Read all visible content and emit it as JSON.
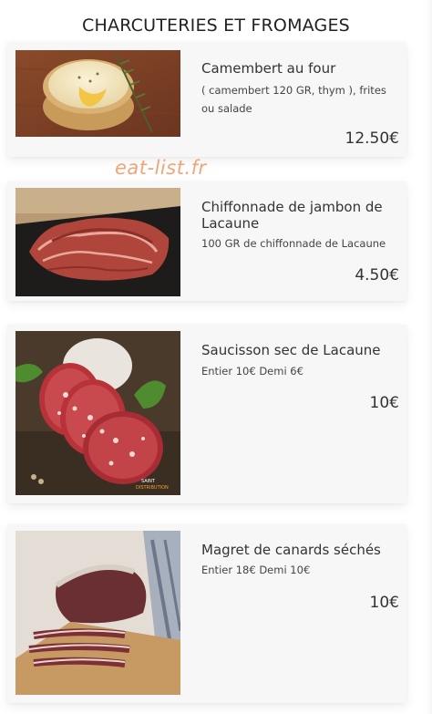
{
  "section": {
    "title": "CHARCUTERIES ET FROMAGES"
  },
  "watermark": "eat-list.fr",
  "items": [
    {
      "name": "Camembert au four",
      "description": "( camembert 120 GR, thym ), frites ou salade",
      "price": "12.50€",
      "image_icon": "camembert-photo"
    },
    {
      "name": "Chiffonnade de jambon de Lacaune",
      "description": "100 GR de chiffonnade de Lacaune",
      "price": "4.50€",
      "image_icon": "ham-photo"
    },
    {
      "name": "Saucisson sec de Lacaune",
      "description": "Entier 10€ Demi 6€",
      "price": "10€",
      "image_icon": "saucisson-photo",
      "image_caption_line1": "SAINT",
      "image_caption_line2": "DISTRIBUTION"
    },
    {
      "name": "Magret de canards séchés",
      "description": "Entier 18€ Demi 10€",
      "price": "10€",
      "image_icon": "magret-photo"
    }
  ]
}
